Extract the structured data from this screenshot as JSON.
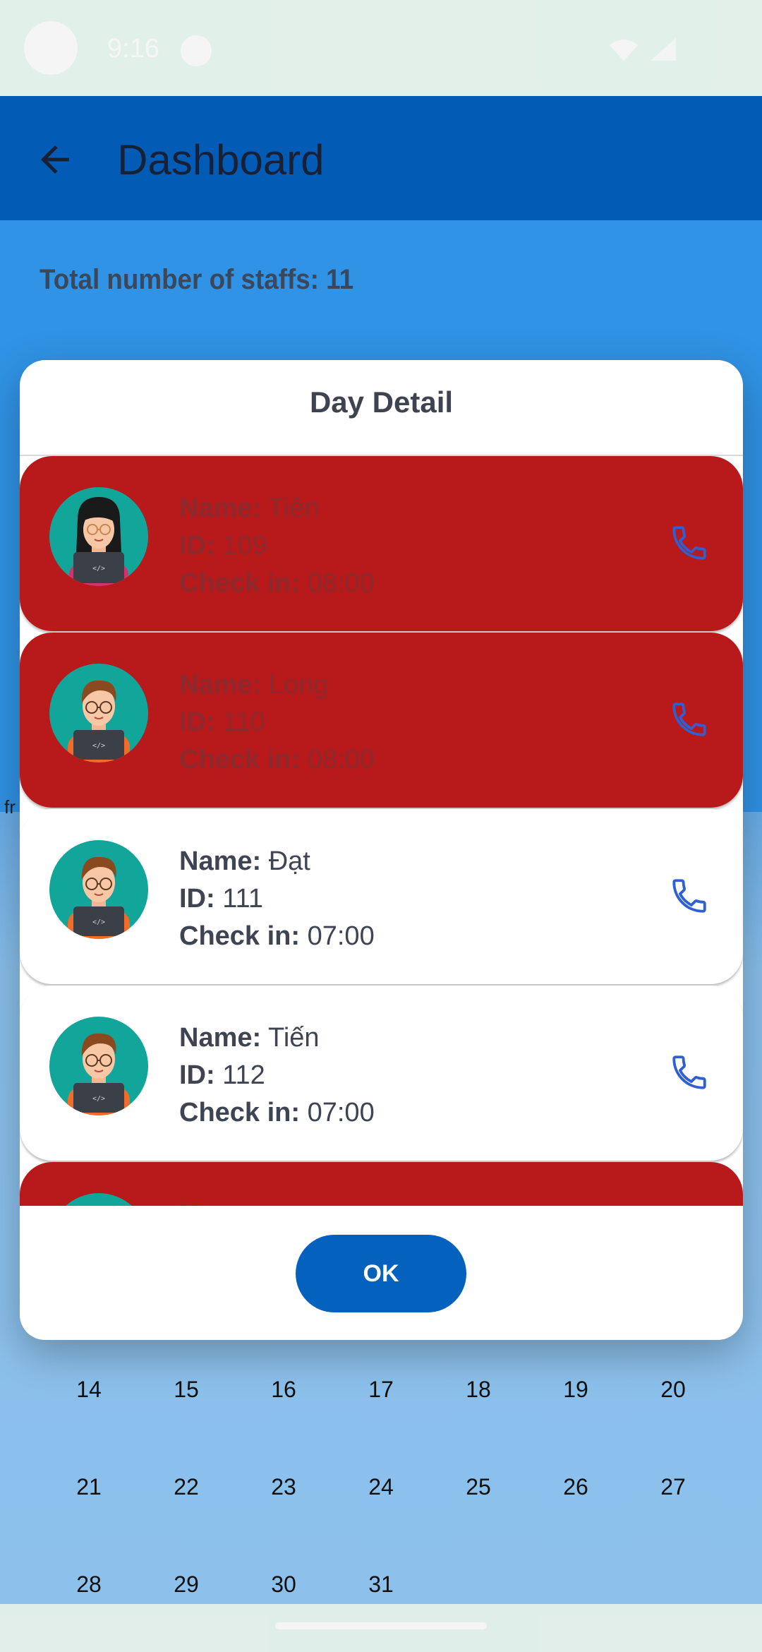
{
  "status_bar": {
    "time": "9:16"
  },
  "app_bar": {
    "title": "Dashboard"
  },
  "summary": {
    "total_staff": "Total number of staffs: 11"
  },
  "edge_text": "fr",
  "dialog": {
    "title": "Day Detail",
    "labels": {
      "name": "Name:",
      "id": "ID:",
      "check_in": "Check in:"
    },
    "staff": [
      {
        "name": "Tiên",
        "id": "109",
        "check_in": "08:00",
        "status": "late",
        "avatar": "female-developer"
      },
      {
        "name": "Long",
        "id": "110",
        "check_in": "08:00",
        "status": "late",
        "avatar": "male-developer"
      },
      {
        "name": "Đạt",
        "id": "111",
        "check_in": "07:00",
        "status": "on-time",
        "avatar": "male-developer"
      },
      {
        "name": "Tiến",
        "id": "112",
        "check_in": "07:00",
        "status": "on-time",
        "avatar": "male-developer"
      },
      {
        "name": "",
        "id": "",
        "check_in": "",
        "status": "late",
        "avatar": "male-developer"
      }
    ],
    "ok_label": "OK"
  },
  "calendar": {
    "rows": [
      [
        "14",
        "15",
        "16",
        "17",
        "18",
        "19",
        "20"
      ],
      [
        "21",
        "22",
        "23",
        "24",
        "25",
        "26",
        "27"
      ],
      [
        "28",
        "29",
        "30",
        "31",
        "",
        "",
        ""
      ]
    ]
  },
  "colors": {
    "app_bar": "#0360bd",
    "background": "#3299ef",
    "late_card": "#b8191b",
    "avatar_bg": "#12a59a",
    "phone_icon": "#2f5fd0",
    "ok_button": "#0461bd"
  },
  "icons": {
    "back": "arrow-left-icon",
    "phone": "phone-icon",
    "wifi": "wifi-icon",
    "signal": "signal-icon"
  }
}
